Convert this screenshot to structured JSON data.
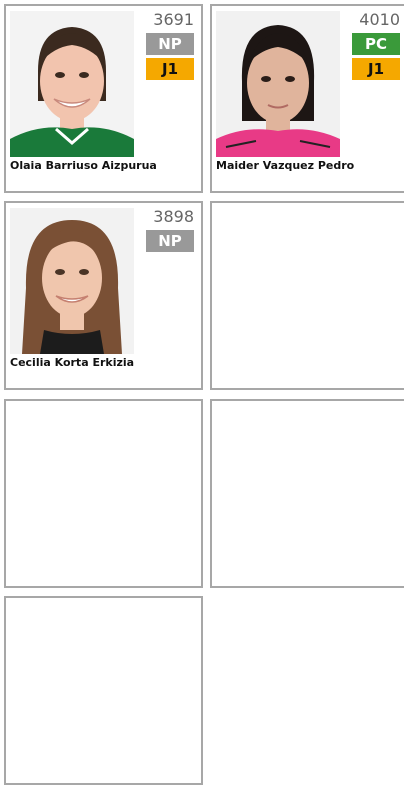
{
  "cards": [
    {
      "number": "3691",
      "badges": [
        {
          "label": "NP",
          "color": "#999999"
        },
        {
          "label": "J1",
          "color": "#f5a800"
        }
      ],
      "name": "Olaia Barriuso Aizpurua",
      "photo_icon": "athlete-photo"
    },
    {
      "number": "4010",
      "badges": [
        {
          "label": "PC",
          "color": "#3a9a3a"
        },
        {
          "label": "J1",
          "color": "#f5a800"
        }
      ],
      "name": "Maider Vazquez Pedro",
      "photo_icon": "athlete-photo"
    },
    {
      "number": "3898",
      "badges": [
        {
          "label": "NP",
          "color": "#999999"
        }
      ],
      "name": "Cecilia Korta Erkizia",
      "photo_icon": "athlete-photo"
    }
  ],
  "empty_cards": 4
}
